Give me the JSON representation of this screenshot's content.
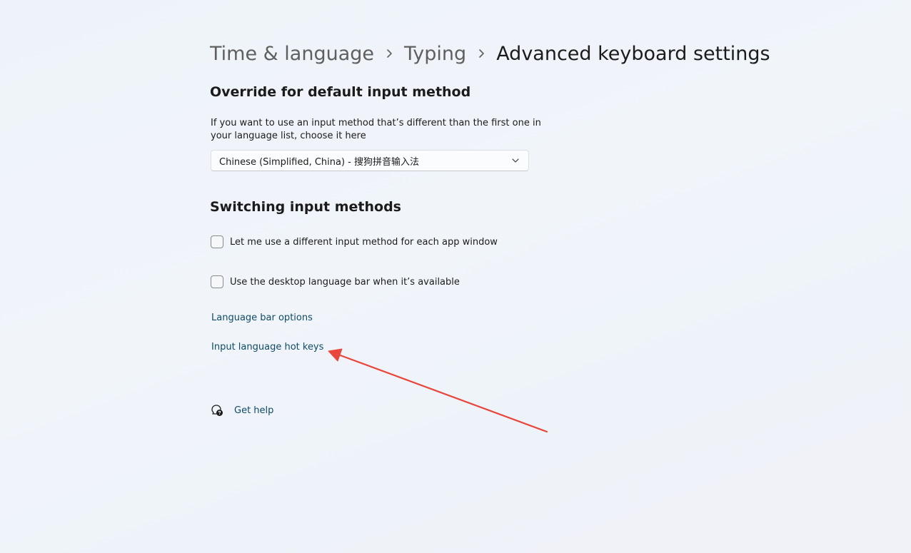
{
  "breadcrumb": {
    "items": [
      "Time & language",
      "Typing"
    ],
    "current": "Advanced keyboard settings"
  },
  "override_section": {
    "heading": "Override for default input method",
    "description": "If you want to use an input method that’s different than the first one in your language list, choose it here",
    "dropdown_value": "Chinese (Simplified, China) - 搜狗拼音输入法"
  },
  "switching_section": {
    "heading": "Switching input methods",
    "checkboxes": [
      {
        "label": "Let me use a different input method for each app window",
        "checked": false
      },
      {
        "label": "Use the desktop language bar when it’s available",
        "checked": false
      }
    ],
    "links": [
      "Language bar options",
      "Input language hot keys"
    ]
  },
  "help": {
    "label": "Get help",
    "icon": "help-chat-icon"
  },
  "annotation": {
    "color": "#e8473c",
    "icon": "red-arrow"
  },
  "colors": {
    "link": "#0e4a66",
    "text": "#1b1b1b",
    "breadcrumb_prev": "#5f5f5f"
  }
}
